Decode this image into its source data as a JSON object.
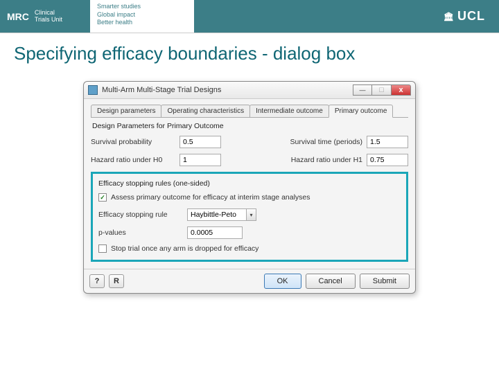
{
  "header": {
    "mrc_logo": "MRC",
    "mrc_sub1": "Clinical",
    "mrc_sub2": "Trials Unit",
    "tagline1": "Smarter studies",
    "tagline2": "Global impact",
    "tagline3": "Better health",
    "ucl_label": "UCL"
  },
  "slide": {
    "title": "Specifying efficacy boundaries - dialog box"
  },
  "dialog": {
    "title": "Multi-Arm Multi-Stage Trial Designs",
    "tabs": {
      "t0": "Design parameters",
      "t1": "Operating characteristics",
      "t2": "Intermediate outcome",
      "t3": "Primary outcome"
    },
    "section_title": "Design Parameters for Primary Outcome",
    "fields": {
      "surv_prob_label": "Survival probability",
      "surv_prob_val": "0.5",
      "surv_time_label": "Survival time (periods)",
      "surv_time_val": "1.5",
      "hr_h0_label": "Hazard ratio under H0",
      "hr_h0_val": "1",
      "hr_h1_label": "Hazard ratio under H1",
      "hr_h1_val": "0.75"
    },
    "efficacy": {
      "legend": "Efficacy stopping rules (one-sided)",
      "assess_checked": true,
      "assess_label": "Assess primary outcome for efficacy at interim stage analyses",
      "rule_label": "Efficacy stopping rule",
      "rule_value": "Haybittle-Peto",
      "pvalues_label": "p-values",
      "pvalues_val": "0.0005",
      "stop_checked": false,
      "stop_label": "Stop trial once any arm is dropped for efficacy"
    },
    "buttons": {
      "help": "?",
      "reset": "R",
      "ok": "OK",
      "cancel": "Cancel",
      "submit": "Submit"
    }
  }
}
